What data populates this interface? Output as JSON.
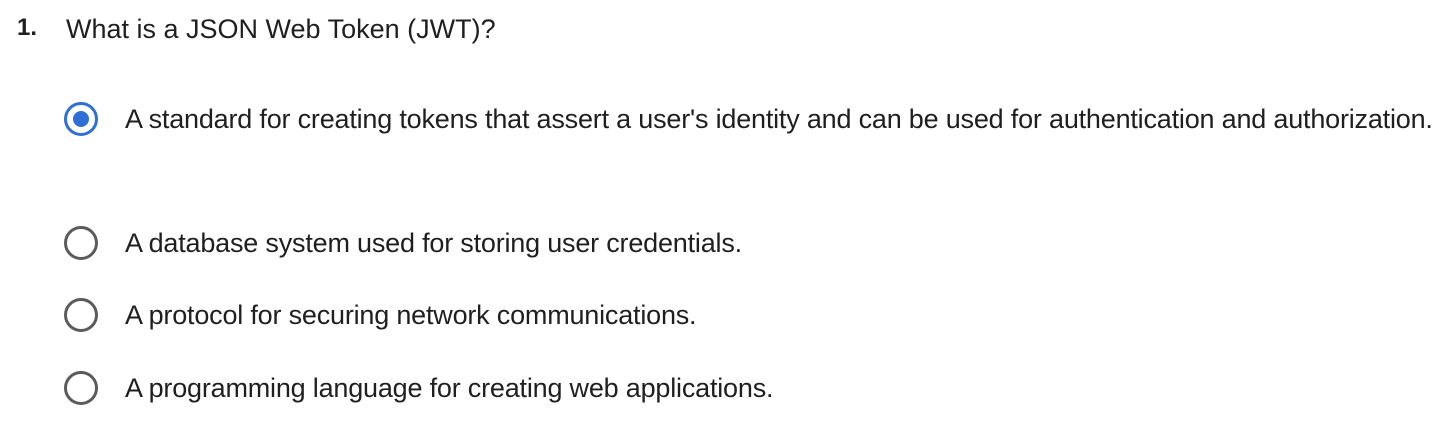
{
  "question": {
    "number": "1.",
    "text": "What is a JSON Web Token (JWT)?"
  },
  "options": [
    {
      "label": "A standard for creating tokens that assert a user's identity and can be used for authentication and authorization.",
      "selected": true
    },
    {
      "label": "A database system used for storing user credentials.",
      "selected": false
    },
    {
      "label": "A protocol for securing network communications.",
      "selected": false
    },
    {
      "label": "A programming language for creating web applications.",
      "selected": false
    }
  ],
  "colors": {
    "accent": "#2f6fd6",
    "radio_border": "#5b5b5b",
    "text": "#1f1f1f"
  }
}
